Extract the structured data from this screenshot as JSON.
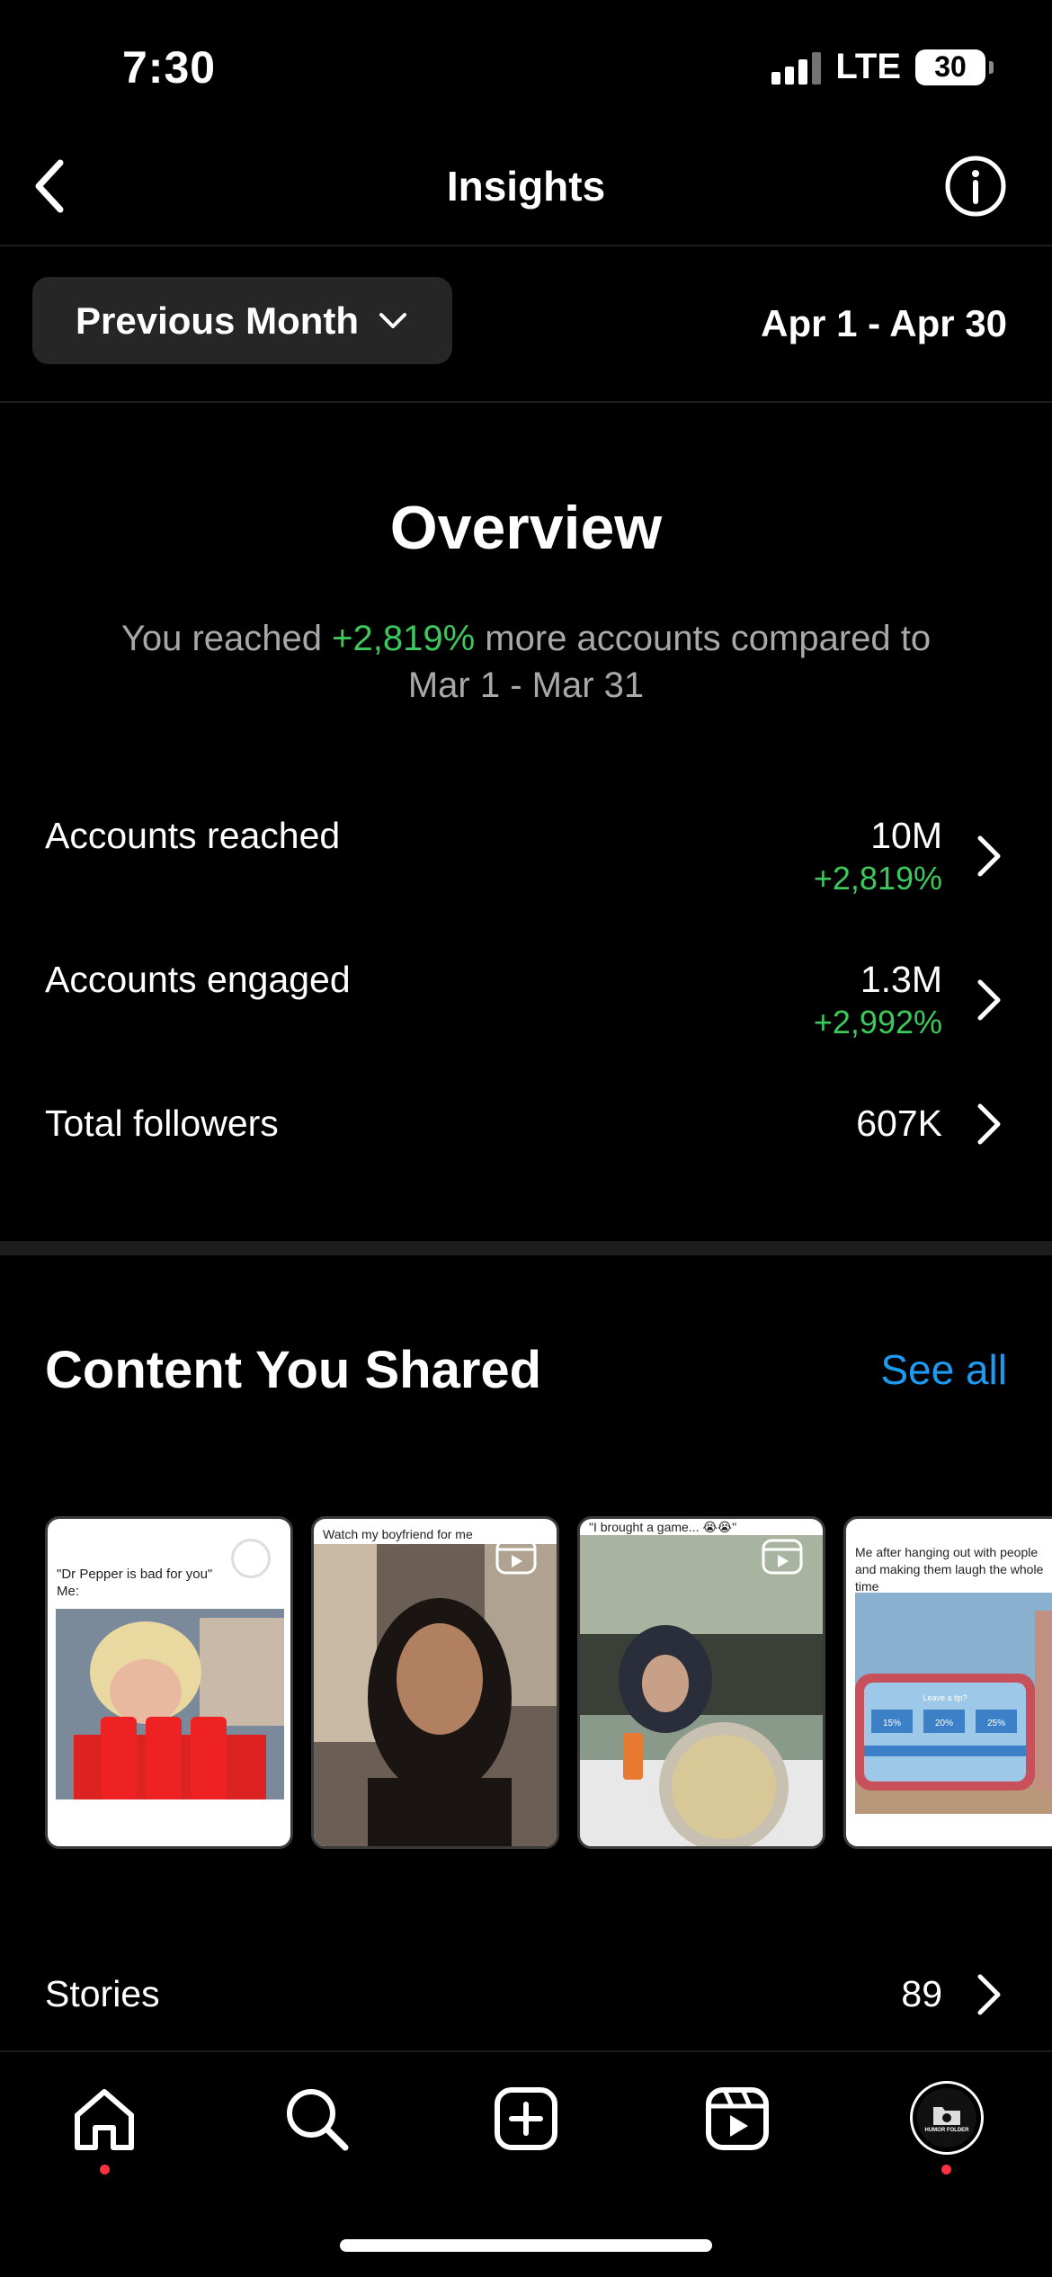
{
  "status_bar": {
    "time": "7:30",
    "network": "LTE",
    "battery": "30"
  },
  "header": {
    "title": "Insights"
  },
  "date_filter": {
    "selected": "Previous Month",
    "range": "Apr 1 - Apr 30"
  },
  "overview": {
    "title": "Overview",
    "desc_prefix": "You reached ",
    "desc_change": "+2,819%",
    "desc_suffix": " more accounts compared to Mar 1 - Mar 31",
    "metrics": [
      {
        "label": "Accounts reached",
        "value": "10M",
        "change": "+2,819%"
      },
      {
        "label": "Accounts engaged",
        "value": "1.3M",
        "change": "+2,992%"
      },
      {
        "label": "Total followers",
        "value": "607K",
        "change": ""
      }
    ]
  },
  "content": {
    "title": "Content You Shared",
    "see_all": "See all",
    "posts": [
      {
        "caption": "\"Dr Pepper is bad for you\"\nMe:",
        "kind": "post"
      },
      {
        "caption": "Watch my boyfriend for me",
        "kind": "reel"
      },
      {
        "caption": "\"I brought a game... 😭😭\"",
        "kind": "reel"
      },
      {
        "caption": "Me after hanging out with people and making them laugh the whole time",
        "kind": "post"
      }
    ],
    "phone_screen": {
      "question": "Leave a tip?",
      "options": [
        "15%",
        "20%",
        "25%"
      ]
    }
  },
  "stories": {
    "label": "Stories",
    "value": "89"
  },
  "tabbar": {
    "avatar_text": "HUMOR FOLDER"
  },
  "colors": {
    "accent_green": "#3cc85c",
    "link_blue": "#1d9bf0",
    "notification_red": "#ff3040"
  }
}
